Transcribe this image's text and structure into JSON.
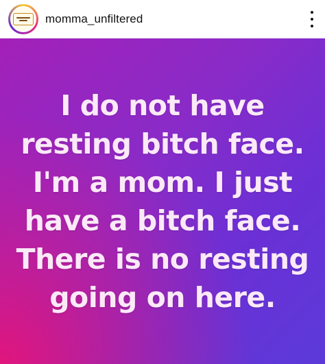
{
  "header": {
    "username": "momma_unfiltered",
    "avatar_icon": "momma-unfiltered-logo",
    "menu_icon": "more-vertical-icon"
  },
  "post": {
    "text": "I do not have resting bitch face. I'm a mom. I just have a bitch face. There is no resting going on here.",
    "colors": {
      "gradient_start": "#a320b8",
      "gradient_end": "#5b3ad8",
      "accent_pink": "#e61478",
      "text": "#fbe9f8"
    }
  }
}
